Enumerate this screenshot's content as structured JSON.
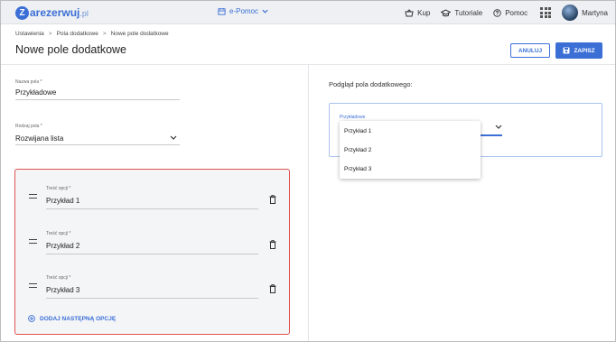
{
  "brand": {
    "logo_letter": "Z",
    "name": "arezerwuj",
    "tld": ".pl"
  },
  "topbar": {
    "center_menu": "e-Pomoc",
    "buy": "Kup",
    "tutorials": "Tutoriale",
    "help": "Pomoc",
    "user": "Martyna"
  },
  "breadcrumb": [
    "Ustawienia",
    "Pola dodatkowe",
    "Nowe pole dodatkowe"
  ],
  "page_title": "Nowe pole dodatkowe",
  "actions": {
    "cancel": "ANULUJ",
    "save": "ZAPISZ"
  },
  "form": {
    "name_label": "Nazwa pola *",
    "name_value": "Przykładowe",
    "type_label": "Rodzaj pola *",
    "type_value": "Rozwijana lista"
  },
  "options": [
    {
      "label": "Treść opcji *",
      "value": "Przykład 1"
    },
    {
      "label": "Treść opcji *",
      "value": "Przykład 2"
    },
    {
      "label": "Treść opcji *",
      "value": "Przykład 3"
    }
  ],
  "add_option": "DODAJ NASTĘPNĄ OPCJĘ",
  "preview": {
    "title": "Podgląd pola dodatkowego:",
    "label": "Przykładowe",
    "dropdown_items": [
      "Przykład 1",
      "Przykład 2",
      "Przykład 3"
    ]
  },
  "colors": {
    "accent": "#3b6fd6",
    "highlight_border": "#e05252"
  }
}
